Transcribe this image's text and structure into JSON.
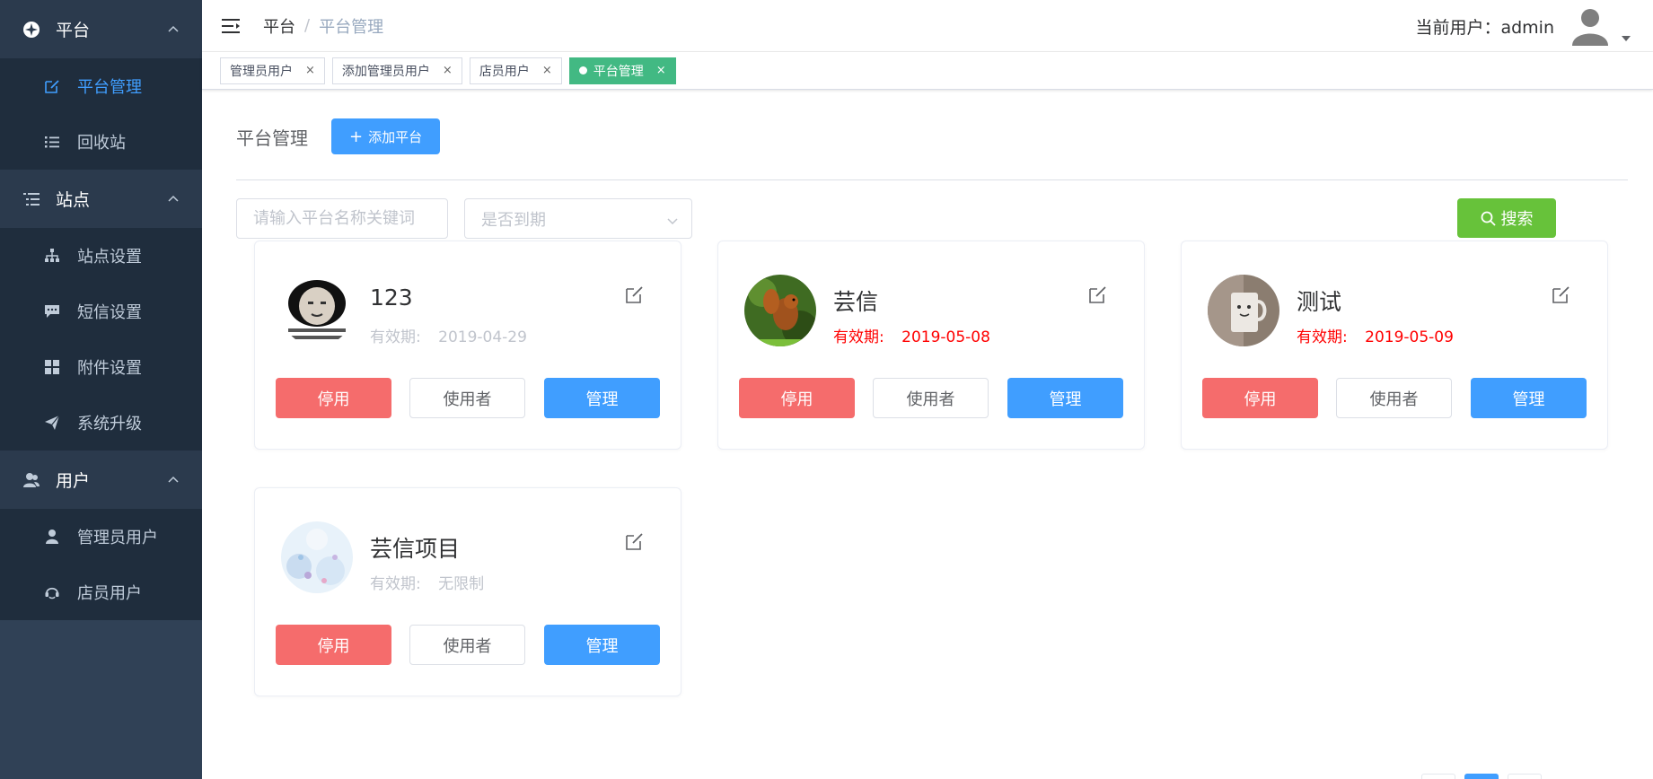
{
  "sidebar": {
    "groups": [
      {
        "title": "平台",
        "icon": "compass-icon",
        "items": [
          {
            "label": "平台管理",
            "icon": "edit-icon",
            "active": true
          },
          {
            "label": "回收站",
            "icon": "list-icon",
            "active": false
          }
        ]
      },
      {
        "title": "站点",
        "icon": "task-list-icon",
        "items": [
          {
            "label": "站点设置",
            "icon": "sitemap-icon",
            "active": false
          },
          {
            "label": "短信设置",
            "icon": "message-icon",
            "active": false
          },
          {
            "label": "附件设置",
            "icon": "grid-icon",
            "active": false
          },
          {
            "label": "系统升级",
            "icon": "send-icon",
            "active": false
          }
        ]
      },
      {
        "title": "用户",
        "icon": "users-icon",
        "items": [
          {
            "label": "管理员用户",
            "icon": "user-icon",
            "active": false
          },
          {
            "label": "店员用户",
            "icon": "headset-icon",
            "active": false
          }
        ]
      }
    ]
  },
  "header": {
    "breadcrumb": {
      "home": "平台",
      "separator": "/",
      "current": "平台管理"
    },
    "user_label": "当前用户：admin"
  },
  "tags": [
    {
      "label": "管理员用户",
      "close": "×",
      "active": false
    },
    {
      "label": "添加管理员用户",
      "close": "×",
      "active": false
    },
    {
      "label": "店员用户",
      "close": "×",
      "active": false
    },
    {
      "label": "平台管理",
      "close": "×",
      "active": true
    }
  ],
  "main": {
    "title": "平台管理",
    "add_button": {
      "plus": "+",
      "label": "添加平台"
    },
    "search": {
      "placeholder": "请输入平台名称关键词"
    },
    "select": {
      "placeholder": "是否到期"
    },
    "search_button": "搜索"
  },
  "cards": [
    {
      "name": "123",
      "validity_label": "有效期:",
      "validity_value": "2019-04-29",
      "expired": false,
      "thumb": "panda-meme",
      "buttons": {
        "stop": "停用",
        "users": "使用者",
        "manage": "管理"
      }
    },
    {
      "name": "芸信",
      "validity_label": "有效期:",
      "validity_value": "2019-05-08",
      "expired": true,
      "thumb": "squirrel",
      "buttons": {
        "stop": "停用",
        "users": "使用者",
        "manage": "管理"
      }
    },
    {
      "name": "测试",
      "validity_label": "有效期:",
      "validity_value": "2019-05-09",
      "expired": true,
      "thumb": "cup",
      "buttons": {
        "stop": "停用",
        "users": "使用者",
        "manage": "管理"
      }
    },
    {
      "name": "芸信项目",
      "validity_label": "有效期:",
      "validity_value": "无限制",
      "expired": false,
      "thumb": "flowers",
      "buttons": {
        "stop": "停用",
        "users": "使用者",
        "manage": "管理"
      }
    }
  ],
  "colors": {
    "sidebar_bg": "#304156",
    "submenu_bg": "#1f2d3d",
    "primary": "#409eff",
    "success": "#67c23a",
    "danger": "#f56c6c",
    "tag_active": "#42b983",
    "expired_text": "#ff0000"
  }
}
